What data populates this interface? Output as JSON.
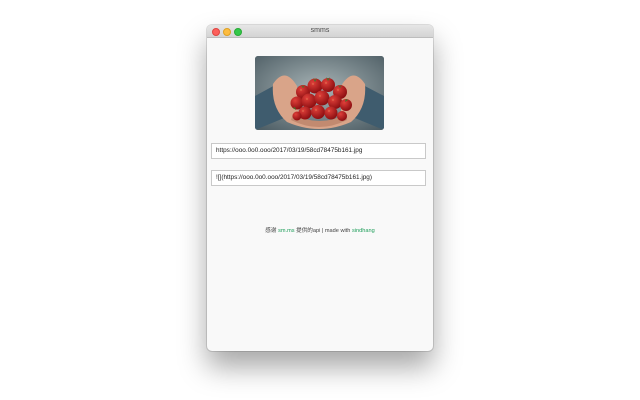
{
  "window": {
    "title": "smms"
  },
  "image": {
    "description_icon": "strawberries-photo"
  },
  "fields": {
    "url_value": "https://ooo.0o0.ooo/2017/03/19/58cd78475b161.jpg",
    "markdown_value": "![](https://ooo.0o0.ooo/2017/03/19/58cd78475b161.jpg)"
  },
  "footer": {
    "thanks_prefix": "感谢",
    "smms_link": "sm.ms",
    "thanks_suffix": "提供的api | made with",
    "author_link": "sindhang"
  },
  "colors": {
    "link": "#1e9e5a",
    "close": "#fc605c",
    "minimize": "#fdbc40",
    "maximize": "#34c84a"
  }
}
